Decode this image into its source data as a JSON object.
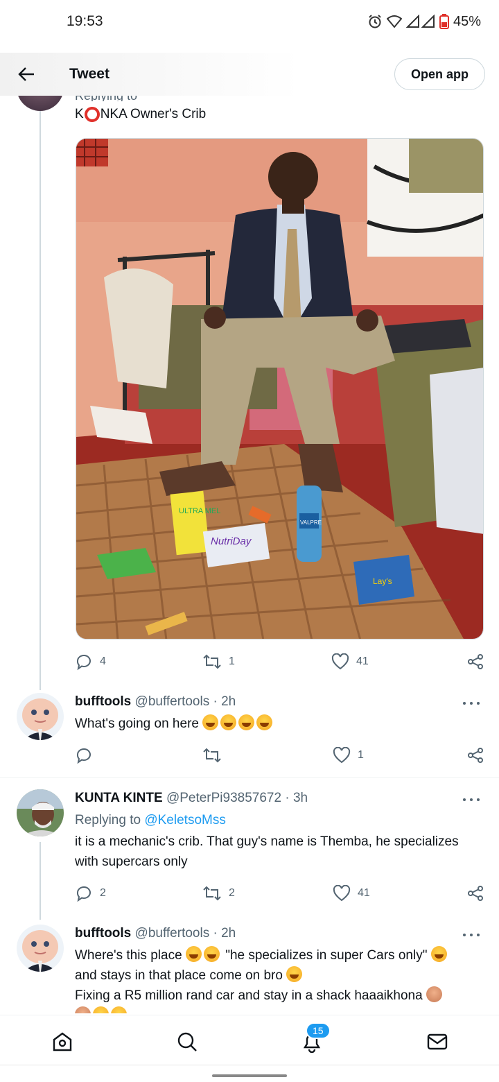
{
  "status_bar": {
    "time": "19:53",
    "battery": "45%"
  },
  "header": {
    "title": "Tweet",
    "open_app_label": "Open app"
  },
  "main_tweet": {
    "text_prefix": "K",
    "text_suffix": "NKA Owner's Crib",
    "media_objects": [
      "ULTRA MEL",
      "NutriDay",
      "VALPRE",
      "Lay's"
    ],
    "stats": {
      "replies": "4",
      "retweets": "1",
      "likes": "41"
    }
  },
  "replies": [
    {
      "name": "bufftools",
      "handle": "@buffertools",
      "time": "· 2h",
      "text": "What's going on here",
      "stats": {
        "replies": "",
        "retweets": "",
        "likes": "1"
      }
    },
    {
      "name": "KUNTA KINTE",
      "handle": "@PeterPi93857672",
      "time": "· 3h",
      "replying_prefix": "Replying to",
      "replying_handle": "@KeletsoMss",
      "text": "it is a mechanic's crib. That guy's name is Themba, he specializes with supercars only",
      "stats": {
        "replies": "2",
        "retweets": "2",
        "likes": "41"
      }
    },
    {
      "name": "bufftools",
      "handle": "@buffertools",
      "time": "· 2h",
      "text_line1a": "Where's this place",
      "text_line1b": "\"he specializes in super Cars only\"",
      "text_line2": "and stays in that place come on bro",
      "text_line3": "Fixing a R5 million rand car and stay in a shack haaaikhona"
    }
  ],
  "bottom_nav": {
    "notifications_badge": "15"
  }
}
